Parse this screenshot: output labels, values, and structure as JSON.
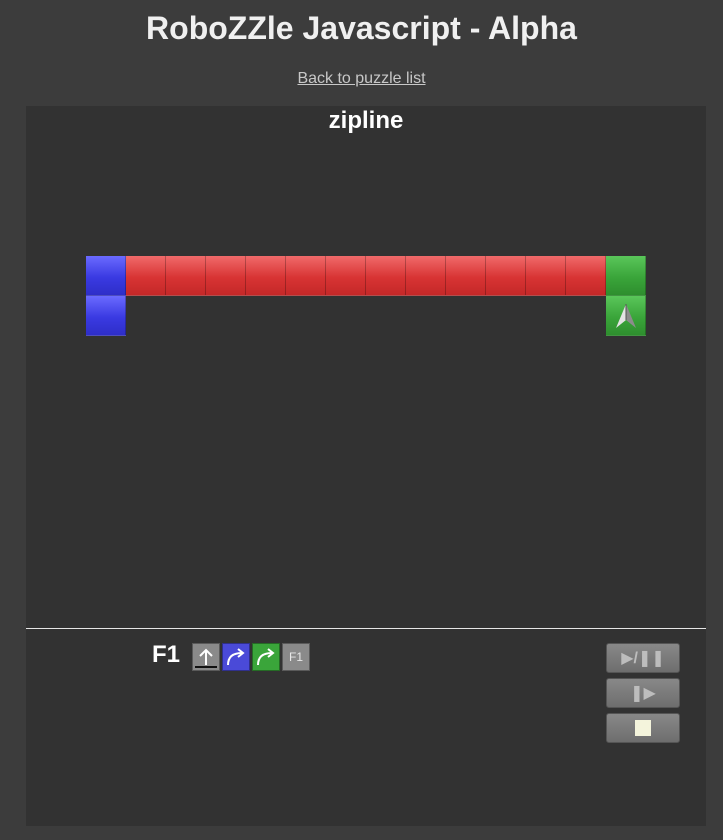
{
  "header": {
    "title": "RoboZZle Javascript - Alpha",
    "back_link": "Back to puzzle list"
  },
  "puzzle": {
    "name": "zipline",
    "board": {
      "rows": [
        [
          "blue",
          "red",
          "red",
          "red",
          "red",
          "red",
          "red",
          "red",
          "red",
          "red",
          "red",
          "red",
          "red",
          "green"
        ],
        [
          "blue",
          "",
          "",
          "",
          "",
          "",
          "",
          "",
          "",
          "",
          "",
          "",
          "",
          "green"
        ]
      ],
      "robot": {
        "row": 1,
        "col": 13,
        "direction": "up"
      }
    }
  },
  "program": {
    "function_label": "F1",
    "slots": [
      {
        "color": "gray",
        "command": "forward-icon"
      },
      {
        "color": "blue",
        "command": "turn-right-icon"
      },
      {
        "color": "green",
        "command": "turn-right-icon"
      },
      {
        "color": "gray",
        "command": "call-f1",
        "label": "F1"
      }
    ]
  },
  "controls": {
    "play_pause": "▶/❚❚",
    "step": "❚▶",
    "stop": "■"
  },
  "colors": {
    "background": "#3c3c3c",
    "panel": "#323232",
    "red": "#d83434",
    "blue": "#3a3ae2",
    "green": "#3aa53a"
  }
}
